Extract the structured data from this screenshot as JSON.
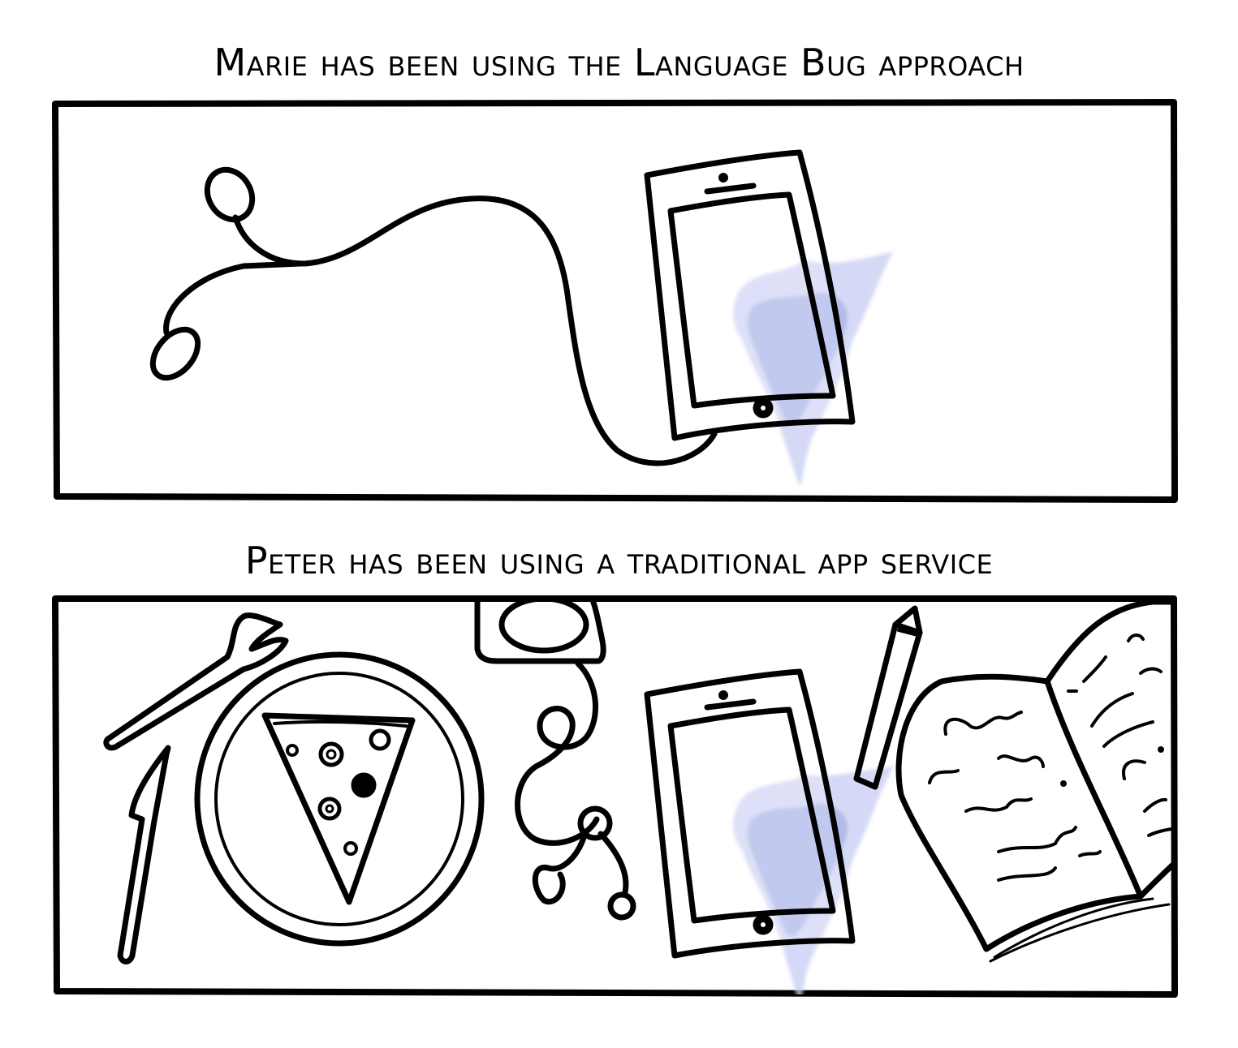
{
  "panels": [
    {
      "caption": "Marie has been using the Language Bug approach",
      "items": [
        "earphones",
        "tablet"
      ]
    },
    {
      "caption": "Peter has been using a traditional app service",
      "items": [
        "fork",
        "knife",
        "plate-with-pizza",
        "earphones",
        "tablet",
        "pencil",
        "open-book"
      ]
    }
  ],
  "colors": {
    "ink": "#000000",
    "splash": "#8896d8",
    "background": "#ffffff"
  }
}
